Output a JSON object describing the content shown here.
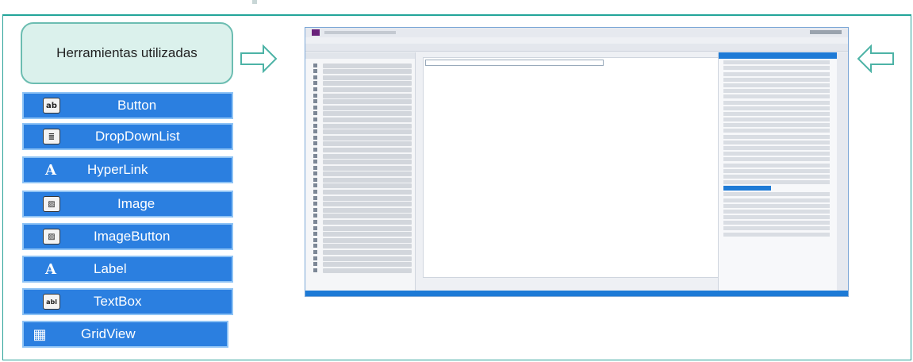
{
  "heading": "Herramientas utilizadas",
  "tools": [
    {
      "label": "Button",
      "icon": "button-icon",
      "glyph": "ab"
    },
    {
      "label": "DropDownList",
      "icon": "dropdownlist-icon",
      "glyph": "≣"
    },
    {
      "label": "HyperLink",
      "icon": "hyperlink-icon",
      "glyph": "A"
    },
    {
      "label": "Image",
      "icon": "image-icon",
      "glyph": "▨"
    },
    {
      "label": "ImageButton",
      "icon": "imagebutton-icon",
      "glyph": "▨"
    },
    {
      "label": "Label",
      "icon": "label-icon",
      "glyph": "A"
    },
    {
      "label": "TextBox",
      "icon": "textbox-icon",
      "glyph": "abl"
    },
    {
      "label": "GridView",
      "icon": "gridview-icon",
      "glyph": "▦"
    }
  ],
  "colors": {
    "accent": "#2aa198",
    "tool_bg": "#2b7fe0",
    "heading_bg": "#dbf1ec",
    "vs_blue": "#1d7ad6"
  }
}
